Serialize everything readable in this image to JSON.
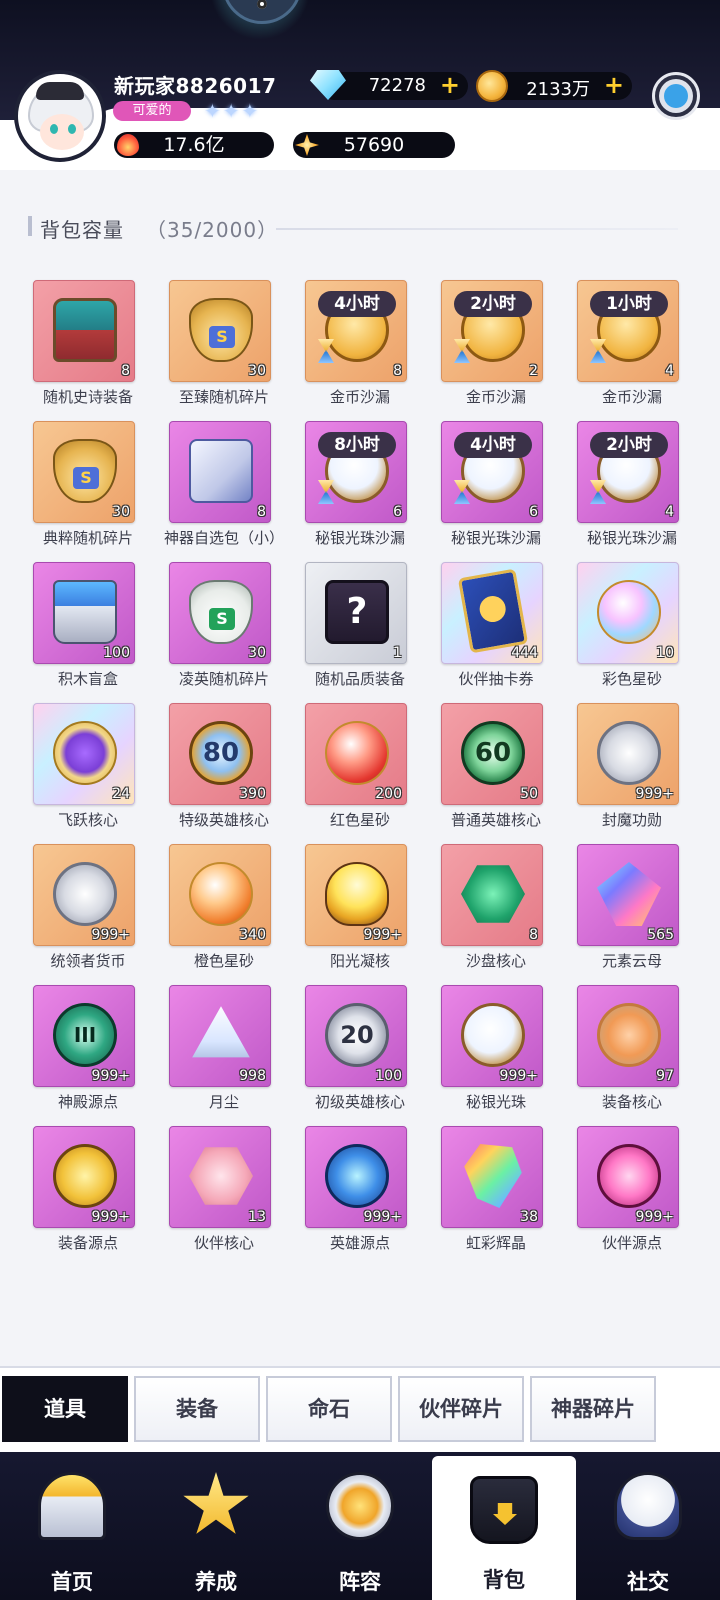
{
  "header": {
    "player_name": "新玩家8826017",
    "title_badge": "可爱的",
    "stars": "✦✦✦",
    "diamonds": "72278",
    "gold": "2133万",
    "plus": "+",
    "power": "17.6亿",
    "star_points": "57690"
  },
  "capacity": {
    "label": "背包容量",
    "count": "（35/2000）"
  },
  "items": [
    {
      "name": "随机史诗装备",
      "qty": "8",
      "bg": "pink",
      "icon": "shape-chest",
      "badge": "",
      "text": ""
    },
    {
      "name": "至臻随机碎片",
      "qty": "30",
      "bg": "orange",
      "icon": "shape-bag",
      "badge": "",
      "text": "S"
    },
    {
      "name": "金币沙漏",
      "qty": "8",
      "bg": "orange",
      "icon": "shape-coin",
      "badge": "4小时",
      "text": ""
    },
    {
      "name": "金币沙漏",
      "qty": "2",
      "bg": "orange",
      "icon": "shape-coin",
      "badge": "2小时",
      "text": ""
    },
    {
      "name": "金币沙漏",
      "qty": "4",
      "bg": "orange",
      "icon": "shape-coin",
      "badge": "1小时",
      "text": ""
    },
    {
      "name": "典粹随机碎片",
      "qty": "30",
      "bg": "orange",
      "icon": "shape-bag",
      "badge": "",
      "text": "S"
    },
    {
      "name": "神器自选包（小）",
      "qty": "8",
      "bg": "purple",
      "icon": "shape-box",
      "badge": "",
      "text": ""
    },
    {
      "name": "秘银光珠沙漏",
      "qty": "6",
      "bg": "purple",
      "icon": "shape-pearl",
      "badge": "8小时",
      "text": ""
    },
    {
      "name": "秘银光珠沙漏",
      "qty": "6",
      "bg": "purple",
      "icon": "shape-pearl",
      "badge": "4小时",
      "text": ""
    },
    {
      "name": "秘银光珠沙漏",
      "qty": "4",
      "bg": "purple",
      "icon": "shape-pearl",
      "badge": "2小时",
      "text": ""
    },
    {
      "name": "积木盲盒",
      "qty": "100",
      "bg": "purple",
      "icon": "shape-blocks",
      "badge": "",
      "text": ""
    },
    {
      "name": "凌英随机碎片",
      "qty": "30",
      "bg": "purple",
      "icon": "shape-bag-green",
      "badge": "",
      "text": "S"
    },
    {
      "name": "随机品质装备",
      "qty": "1",
      "bg": "gray",
      "icon": "shape-mystery",
      "badge": "",
      "text": "?"
    },
    {
      "name": "伙伴抽卡券",
      "qty": "444",
      "bg": "rainbow",
      "icon": "shape-card",
      "badge": "",
      "text": ""
    },
    {
      "name": "彩色星砂",
      "qty": "10",
      "bg": "rainbow",
      "icon": "shape-potion",
      "badge": "",
      "text": ""
    },
    {
      "name": "飞跃核心",
      "qty": "24",
      "bg": "rainbow",
      "icon": "shape-crest",
      "badge": "",
      "text": ""
    },
    {
      "name": "特级英雄核心",
      "qty": "390",
      "bg": "pink",
      "icon": "shape-medal",
      "badge": "",
      "text": "80"
    },
    {
      "name": "红色星砂",
      "qty": "200",
      "bg": "pink",
      "icon": "shape-potion-red",
      "badge": "",
      "text": ""
    },
    {
      "name": "普通英雄核心",
      "qty": "50",
      "bg": "pink",
      "icon": "shape-medal-green",
      "badge": "",
      "text": "60"
    },
    {
      "name": "封魔功勋",
      "qty": "999+",
      "bg": "orange",
      "icon": "shape-silver",
      "badge": "",
      "text": ""
    },
    {
      "name": "统领者货币",
      "qty": "999+",
      "bg": "orange",
      "icon": "shape-silver",
      "badge": "",
      "text": ""
    },
    {
      "name": "橙色星砂",
      "qty": "340",
      "bg": "orange",
      "icon": "shape-potion-orange",
      "badge": "",
      "text": ""
    },
    {
      "name": "阳光凝核",
      "qty": "999+",
      "bg": "orange",
      "icon": "shape-sun",
      "badge": "",
      "text": ""
    },
    {
      "name": "沙盘核心",
      "qty": "8",
      "bg": "pink",
      "icon": "shape-hex",
      "badge": "",
      "text": ""
    },
    {
      "name": "元素云母",
      "qty": "565",
      "bg": "purple",
      "icon": "shape-prism",
      "badge": "",
      "text": ""
    },
    {
      "name": "神殿源点",
      "qty": "999+",
      "bg": "purple",
      "icon": "shape-temple",
      "badge": "",
      "text": "III"
    },
    {
      "name": "月尘",
      "qty": "998",
      "bg": "purple",
      "icon": "shape-dust",
      "badge": "",
      "text": ""
    },
    {
      "name": "初级英雄核心",
      "qty": "100",
      "bg": "purple",
      "icon": "shape-medal-gray",
      "badge": "",
      "text": "20"
    },
    {
      "name": "秘银光珠",
      "qty": "999+",
      "bg": "purple",
      "icon": "shape-pearl",
      "badge": "",
      "text": ""
    },
    {
      "name": "装备核心",
      "qty": "97",
      "bg": "purple",
      "icon": "shape-gear-core",
      "badge": "",
      "text": ""
    },
    {
      "name": "装备源点",
      "qty": "999+",
      "bg": "purple",
      "icon": "shape-sword",
      "badge": "",
      "text": ""
    },
    {
      "name": "伙伴核心",
      "qty": "13",
      "bg": "purple",
      "icon": "shape-partner",
      "badge": "",
      "text": ""
    },
    {
      "name": "英雄源点",
      "qty": "999+",
      "bg": "purple",
      "icon": "shape-hero",
      "badge": "",
      "text": ""
    },
    {
      "name": "虹彩辉晶",
      "qty": "38",
      "bg": "purple",
      "icon": "shape-crystal",
      "badge": "",
      "text": ""
    },
    {
      "name": "伙伴源点",
      "qty": "999+",
      "bg": "purple",
      "icon": "shape-partner-src",
      "badge": "",
      "text": ""
    }
  ],
  "category_tabs": [
    {
      "label": "道具",
      "active": true
    },
    {
      "label": "装备",
      "active": false
    },
    {
      "label": "命石",
      "active": false
    },
    {
      "label": "伙伴碎片",
      "active": false
    },
    {
      "label": "神器碎片",
      "active": false
    }
  ],
  "bottom_nav": [
    {
      "label": "首页",
      "icon": "ni-home",
      "active": false
    },
    {
      "label": "养成",
      "icon": "ni-grow",
      "active": false
    },
    {
      "label": "阵容",
      "icon": "ni-lineup",
      "active": false
    },
    {
      "label": "背包",
      "icon": "ni-bag",
      "active": true
    },
    {
      "label": "社交",
      "icon": "ni-social",
      "active": false
    }
  ]
}
